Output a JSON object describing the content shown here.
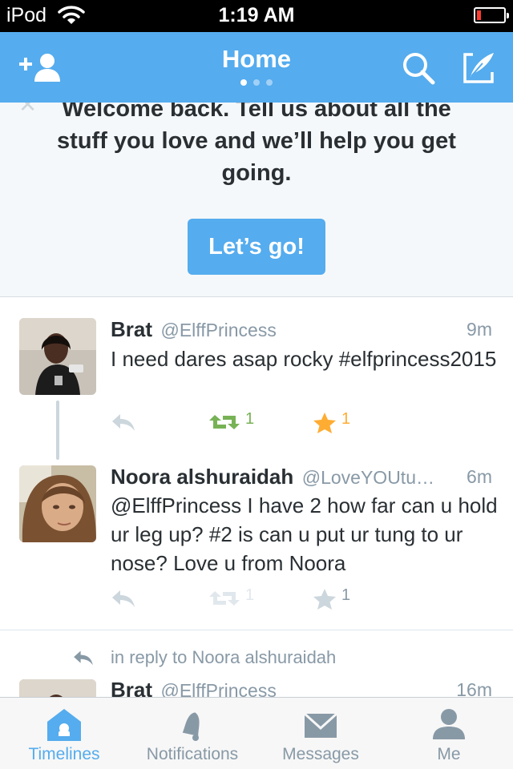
{
  "status_bar": {
    "carrier": "iPod",
    "time": "1:19 AM"
  },
  "nav": {
    "title": "Home",
    "icons": [
      "add-user-icon",
      "search-icon",
      "compose-icon"
    ],
    "page_dots": {
      "count": 3,
      "active": 1
    }
  },
  "welcome": {
    "text": "Welcome back. Tell us about all the stuff you love and we’ll help you get going.",
    "button": "Let’s go!"
  },
  "tweets": [
    {
      "name": "Brat",
      "handle": "@ElffPrincess",
      "time": "9m",
      "text": "I need dares asap rocky #elfprincess2015",
      "retweets": "1",
      "favorites": "1",
      "retweeted": true,
      "favorited": true
    },
    {
      "name": "Noora alshuraidah",
      "handle": "@LoveYOUtu…",
      "time": "6m",
      "text": "@ElffPrincess I have 2 how far can u hold ur leg up? #2 is can u put ur tung to ur nose? Love u from Noora",
      "retweets": "1",
      "favorites": "1",
      "retweeted": false,
      "favorited": false
    },
    {
      "name": "Brat",
      "handle": "@ElffPrincess",
      "time": "16m"
    }
  ],
  "reply_context": "in reply to Noora alshuraidah",
  "tabs": [
    {
      "label": "Timelines",
      "icon": "home-icon",
      "active": true
    },
    {
      "label": "Notifications",
      "icon": "bell-icon",
      "active": false
    },
    {
      "label": "Messages",
      "icon": "envelope-icon",
      "active": false
    },
    {
      "label": "Me",
      "icon": "person-icon",
      "active": false
    }
  ],
  "colors": {
    "brand": "#55acee",
    "retweet": "#77b255",
    "favorite": "#ffac33",
    "muted": "#8899a6"
  }
}
